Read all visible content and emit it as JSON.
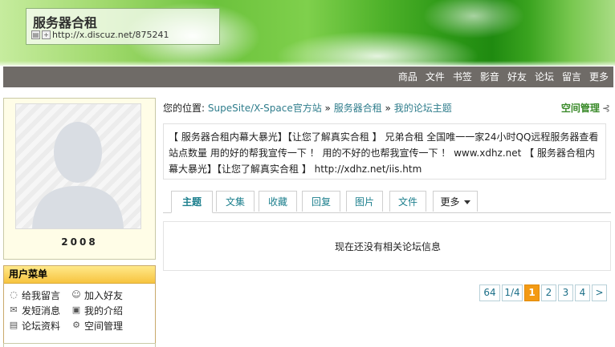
{
  "header": {
    "site_title": "服务器合租",
    "site_url": "http://x.discuz.net/875241"
  },
  "nav": {
    "items": [
      "商品",
      "文件",
      "书签",
      "影音",
      "好友",
      "论坛",
      "留言",
      "更多"
    ]
  },
  "profile": {
    "username": "2008"
  },
  "user_menu": {
    "title": "用户菜单",
    "items": [
      {
        "label": "给我留言",
        "icon": "comment-icon"
      },
      {
        "label": "加入好友",
        "icon": "add-friend-icon"
      },
      {
        "label": "发短消息",
        "icon": "mail-icon"
      },
      {
        "label": "我的介绍",
        "icon": "profile-card-icon"
      },
      {
        "label": "论坛资料",
        "icon": "forum-info-icon"
      },
      {
        "label": "空间管理",
        "icon": "settings-icon"
      }
    ]
  },
  "breadcrumb": {
    "prefix": "您的位置:",
    "links": [
      "SupeSite/X-Space官方站",
      "服务器合租",
      "我的论坛主题"
    ],
    "separator": "»"
  },
  "space_manage_label": "空间管理",
  "announcement": "【 服务器合租内幕大暴光】【让您了解真实合租 】 兄弟合租 全国唯一一家24小时QQ远程服务器查看站点数量 用的好的帮我宣传一下 ！ 用的不好的也帮我宣传一下 ！ www.xdhz.net 【 服务器合租内幕大暴光】【让您了解真实合租 】 http://xdhz.net/iis.htm",
  "tabs": {
    "items": [
      "主题",
      "文集",
      "收藏",
      "回复",
      "图片",
      "文件"
    ],
    "active": "主题",
    "more_label": "更多"
  },
  "empty_message": "现在还没有相关论坛信息",
  "pagination": {
    "items": [
      "64",
      "1/4",
      "1",
      "2",
      "3",
      "4",
      ">"
    ],
    "current": "1"
  },
  "colors": {
    "nav_bg": "#6f6b67",
    "link": "#2f7d8c",
    "accent_green": "#3a8a2a",
    "pager_current": "#f39a14"
  }
}
